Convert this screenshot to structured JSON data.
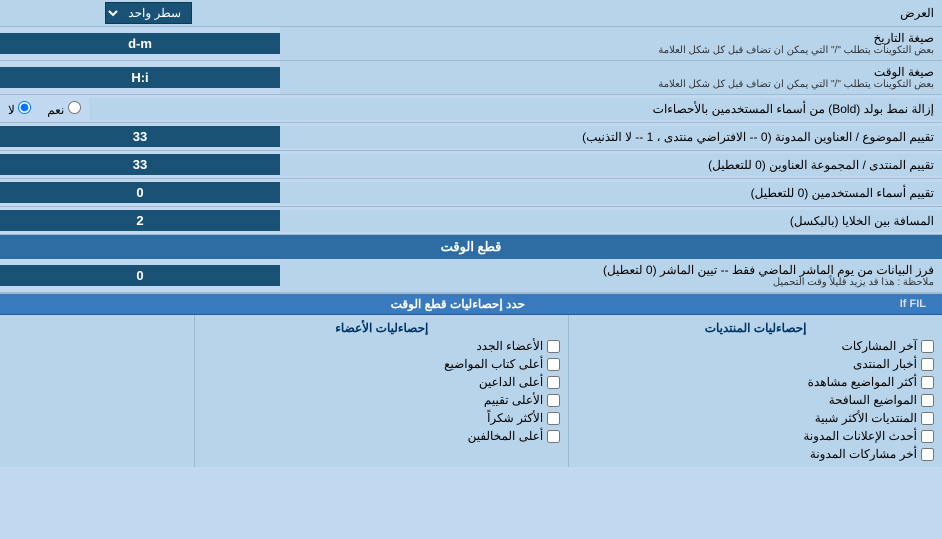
{
  "header": {
    "label": "العرض",
    "select_label": "سطر واحد"
  },
  "date_format": {
    "label": "صيغة التاريخ",
    "sublabel": "بعض التكوينات يتطلب \"/\" التي يمكن ان تضاف قبل كل شكل العلامة",
    "value": "d-m"
  },
  "time_format": {
    "label": "صيغة الوقت",
    "sublabel": "بعض التكوينات يتطلب \"/\" التي يمكن ان تضاف قبل كل شكل العلامة",
    "value": "H:i"
  },
  "bold_remove": {
    "label": "إزالة نمط بولد (Bold) من أسماء المستخدمين بالأحصاءات",
    "yes_label": "نعم",
    "no_label": "لا",
    "selected": "no"
  },
  "topic_order": {
    "label": "تقييم الموضوع / العناوين المدونة (0 -- الافتراضي منتدى ، 1 -- لا التذنيب)",
    "value": "33"
  },
  "forum_order": {
    "label": "تقييم المنتدى / المجموعة العناوين (0 للتعطيل)",
    "value": "33"
  },
  "users_order": {
    "label": "تقييم أسماء المستخدمين (0 للتعطيل)",
    "value": "0"
  },
  "cell_space": {
    "label": "المسافة بين الخلايا (بالبكسل)",
    "value": "2"
  },
  "realtime_section": {
    "label": "قطع الوقت"
  },
  "realtime_filter": {
    "label": "فرز البيانات من يوم الماشر الماضي فقط -- تيين الماشر (0 لتعطيل)",
    "sublabel": "ملاحظة : هذا قد يزيد قليلاً وقت التحميل",
    "value": "0"
  },
  "stats_define": {
    "label": "حدد إحصاءليات قطع الوقت"
  },
  "stats_posts": {
    "header": "إحصاءليات المنتديات",
    "items": [
      "آخر المشاركات",
      "أخبار المنتدى",
      "أكثر المواضيع مشاهدة",
      "المواضيع السافحة",
      "المنتديات الأكثر شبية",
      "أحدث الإعلانات المدونة",
      "أخر مشاركات المدونة"
    ]
  },
  "stats_members": {
    "header": "إحصاءليات الأعضاء",
    "items": [
      "الأعضاء الجدد",
      "أعلى كتاب المواضيع",
      "أعلى الداعين",
      "الأعلى تقييم",
      "الأكثر شكراً",
      "أعلى المخالفين"
    ]
  },
  "stats_top": {
    "label": "If FIL"
  }
}
